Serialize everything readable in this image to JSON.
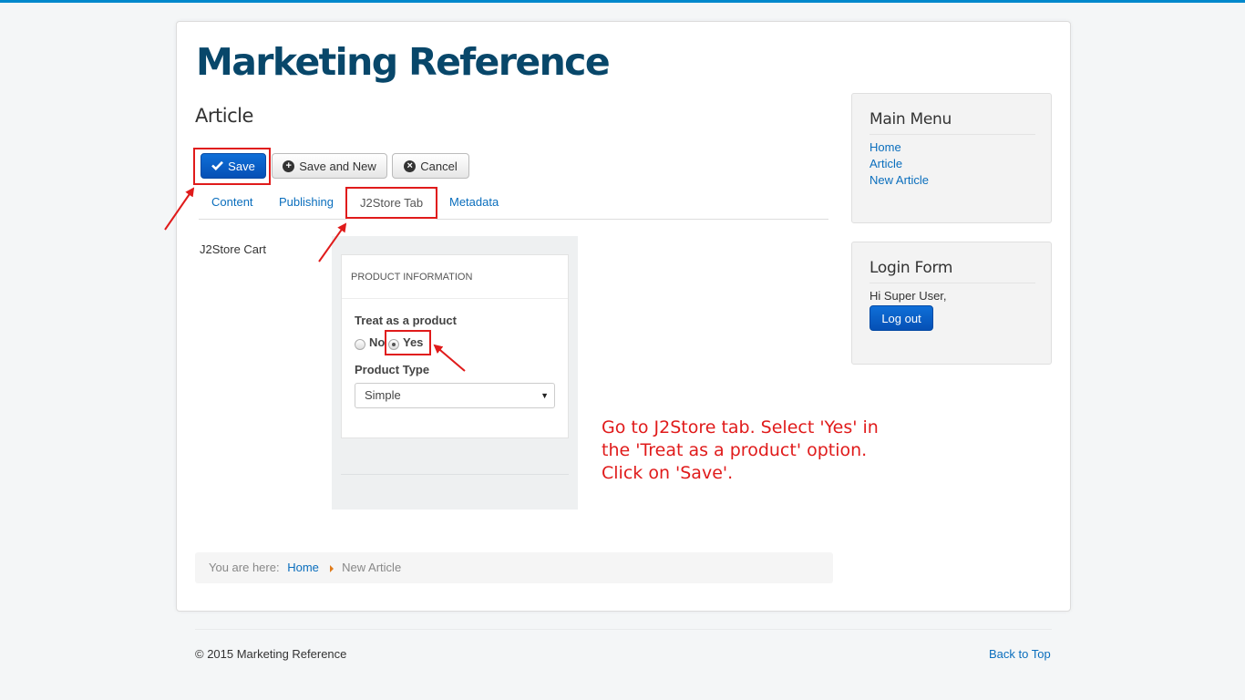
{
  "site": {
    "title": "Marketing Reference"
  },
  "page": {
    "heading": "Article"
  },
  "toolbar": {
    "save_label": "Save",
    "save_and_new_label": "Save and New",
    "cancel_label": "Cancel"
  },
  "tabs": [
    {
      "label": "Content",
      "active": false
    },
    {
      "label": "Publishing",
      "active": false
    },
    {
      "label": "J2Store Tab",
      "active": true
    },
    {
      "label": "Metadata",
      "active": false
    }
  ],
  "j2store": {
    "section_label": "J2Store Cart",
    "panel_heading": "PRODUCT INFORMATION",
    "treat_label": "Treat as a product",
    "option_no": "No",
    "option_yes": "Yes",
    "selected_option": "Yes",
    "product_type_label": "Product Type",
    "product_type_value": "Simple"
  },
  "annotation": {
    "text": "Go to J2Store tab. Select 'Yes' in the 'Treat as a product' option. Click on 'Save'."
  },
  "breadcrumb": {
    "prefix": "You are here:",
    "home": "Home",
    "current": "New Article"
  },
  "sidebar": {
    "main_menu": {
      "title": "Main Menu",
      "items": [
        "Home",
        "Article",
        "New Article"
      ]
    },
    "login": {
      "title": "Login Form",
      "greeting": "Hi Super User,",
      "logout_label": "Log out"
    }
  },
  "footer": {
    "copyright": "© 2015 Marketing Reference",
    "back_to_top": "Back to Top"
  },
  "colors": {
    "accent": "#0088cc",
    "title": "#08476a",
    "primary_button": "#0550b5",
    "highlight": "#e01b1b",
    "link": "#0a6ebd"
  }
}
